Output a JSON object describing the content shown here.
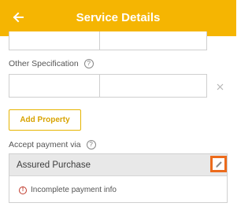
{
  "header": {
    "title": "Service Details",
    "back_icon": "arrow-left-icon"
  },
  "other_specification": {
    "label": "Other Specification",
    "help_icon": "question-circle-icon"
  },
  "add_property": {
    "label": "Add Property"
  },
  "accept_payment": {
    "label": "Accept payment via",
    "help_icon": "question-circle-icon"
  },
  "payment_card": {
    "title": "Assured Purchase",
    "status": "Incomplete payment info",
    "edit_icon": "pencil-icon",
    "warning_icon": "exclamation-circle-icon"
  },
  "colors": {
    "header_bg": "#f5b502",
    "accent": "#e6b400",
    "highlight": "#ec6b1c"
  }
}
